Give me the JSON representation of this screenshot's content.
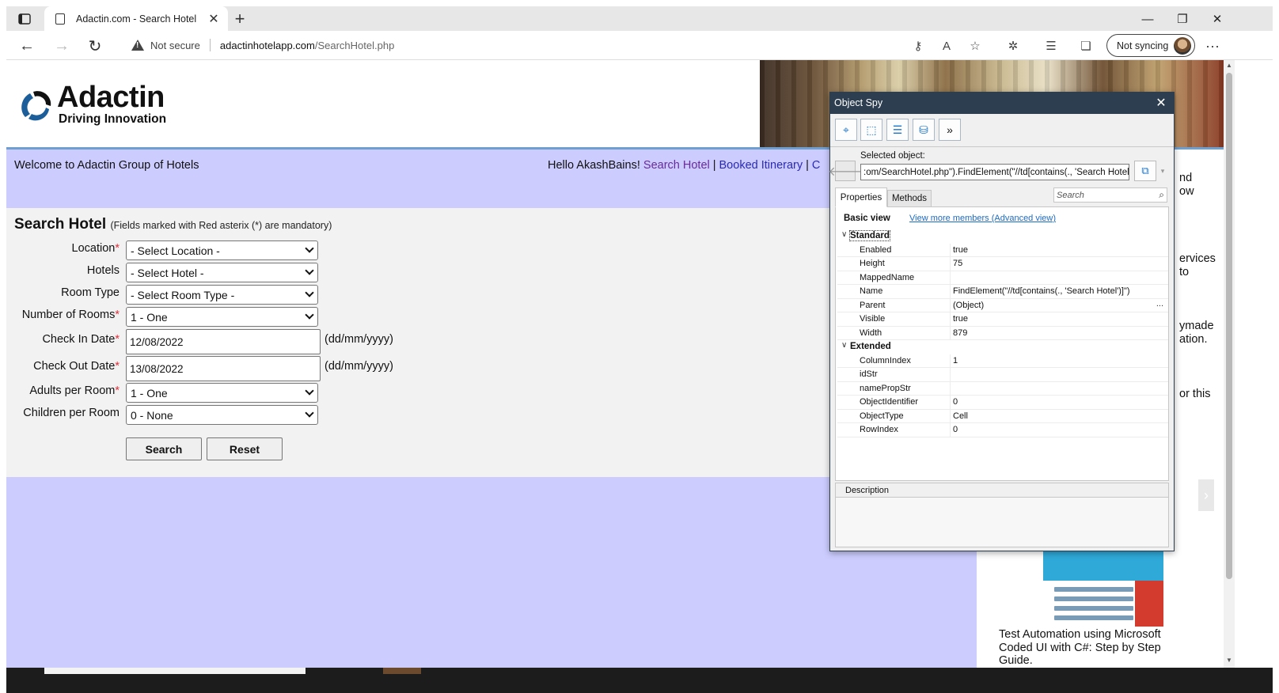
{
  "browser": {
    "tab_title": "Adactin.com - Search Hotel",
    "not_secure": "Not secure",
    "url_host": "adactinhotelapp.com",
    "url_path": "/SearchHotel.php",
    "sync_label": "Not syncing"
  },
  "site": {
    "logo_word": "Adactin",
    "logo_tag": "Driving Innovation",
    "welcome": "Welcome to Adactin Group of Hotels",
    "hello": "Hello AkashBains!",
    "nav_search": "Search Hotel",
    "nav_booked": "Booked Itinerary",
    "nav_more": "C"
  },
  "form": {
    "title": "Search Hotel",
    "subtitle": "(Fields marked with Red asterix (*) are mandatory)",
    "location_label": "Location",
    "location_value": "- Select Location -",
    "hotels_label": "Hotels",
    "hotels_value": "- Select Hotel -",
    "room_type_label": "Room Type",
    "room_type_value": "- Select Room Type -",
    "rooms_label": "Number of Rooms",
    "rooms_value": "1 - One",
    "checkin_label": "Check In Date",
    "checkin_value": "12/08/2022",
    "checkout_label": "Check Out Date",
    "checkout_value": "13/08/2022",
    "date_hint": "(dd/mm/yyyy)",
    "adults_label": "Adults per Room",
    "adults_value": "1 - One",
    "children_label": "Children per Room",
    "children_value": "0 - None",
    "asterisk": "*",
    "search_button": "Search",
    "reset_button": "Reset"
  },
  "right_column": {
    "frag1a": "nd",
    "frag1b": "ow",
    "frag2a": "ervices",
    "frag2b": "to",
    "frag3a": "ymade",
    "frag3b": "ation.",
    "frag4": "or this",
    "book_title": "Test Automation using Microsoft Coded UI with C#: Step by Step Guide."
  },
  "object_spy": {
    "title": "Object Spy",
    "selected_label": "Selected object:",
    "selected_value": ":om/SearchHotel.php\").FindElement(\"//td[contains(., 'Search Hotel')]\")",
    "tab_properties": "Properties",
    "tab_methods": "Methods",
    "search_placeholder": "Search",
    "basic_view": "Basic view",
    "advanced_link": "View more members (Advanced view)",
    "category_standard": "Standard",
    "category_extended": "Extended",
    "standard_props": [
      {
        "name": "Enabled",
        "value": "true"
      },
      {
        "name": "Height",
        "value": "75"
      },
      {
        "name": "MappedName",
        "value": ""
      },
      {
        "name": "Name",
        "value": "FindElement(\"//td[contains(., 'Search Hotel')]\")"
      },
      {
        "name": "Parent",
        "value": "(Object)"
      },
      {
        "name": "Visible",
        "value": "true"
      },
      {
        "name": "Width",
        "value": "879"
      }
    ],
    "extended_props": [
      {
        "name": "ColumnIndex",
        "value": "1"
      },
      {
        "name": "idStr",
        "value": ""
      },
      {
        "name": "namePropStr",
        "value": ""
      },
      {
        "name": "ObjectIdentifier",
        "value": "0"
      },
      {
        "name": "ObjectType",
        "value": "Cell"
      },
      {
        "name": "RowIndex",
        "value": "0"
      }
    ],
    "parent_more": "...",
    "description_label": "Description"
  },
  "colors": {
    "welcome_bg": "#ccccff",
    "form_bg": "#f2f2f2",
    "link": "#2a2ab8",
    "asterisk": "#e0303a",
    "spy_titlebar": "#2c3e50"
  }
}
